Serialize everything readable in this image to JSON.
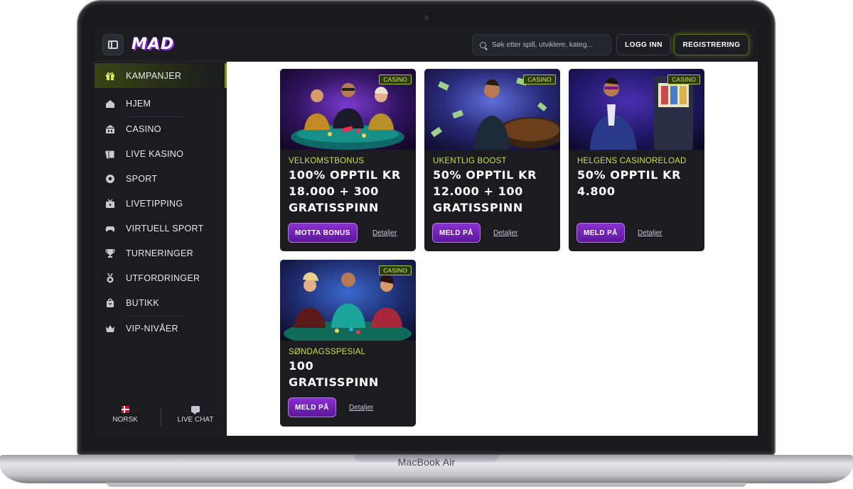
{
  "device": {
    "brand_label": "MacBook Air"
  },
  "header": {
    "logo": "MAD",
    "search_placeholder": "Søk etter spill, utviklere, kateg...",
    "login_label": "LOGG INN",
    "register_label": "REGISTRERING"
  },
  "sidebar": {
    "items": [
      {
        "label": "KAMPANJER",
        "icon": "gift-icon",
        "active": true
      },
      {
        "label": "HJEM",
        "icon": "home-icon"
      },
      {
        "label": "CASINO",
        "icon": "casino-building-icon"
      },
      {
        "label": "LIVE KASINO",
        "icon": "cards-icon"
      },
      {
        "label": "SPORT",
        "icon": "soccer-ball-icon"
      },
      {
        "label": "LIVETIPPING",
        "icon": "live-tv-icon"
      },
      {
        "label": "VIRTUELL SPORT",
        "icon": "gamepad-icon"
      },
      {
        "label": "TURNERINGER",
        "icon": "trophy-icon"
      },
      {
        "label": "UTFORDRINGER",
        "icon": "medal-icon"
      },
      {
        "label": "BUTIKK",
        "icon": "shopping-bag-icon"
      },
      {
        "label": "VIP-NIVÅER",
        "icon": "crown-icon"
      }
    ],
    "footer": {
      "language": "NORSK",
      "chat": "LIVE CHAT"
    }
  },
  "promotions": [
    {
      "badge": "CASINO",
      "eyebrow": "VELKOMSTBONUS",
      "title": "100% OPPTIL KR 18.000 + 300 GRATISSPINN",
      "cta": "MOTTA BONUS",
      "details": "Detaljer"
    },
    {
      "badge": "CASINO",
      "eyebrow": "UKENTLIG BOOST",
      "title": "50% OPPTIL KR 12.000 + 100 GRATISSPINN",
      "cta": "MELD PÅ",
      "details": "Detaljer"
    },
    {
      "badge": "CASINO",
      "eyebrow": "HELGENS CASINORELOAD",
      "title": "50% OPPTIL KR 4.800",
      "cta": "MELD PÅ",
      "details": "Detaljer"
    },
    {
      "badge": "CASINO",
      "eyebrow": "SØNDAGSSPESIAL",
      "title": "100 GRATISSPINN",
      "cta": "MELD PÅ",
      "details": "Detaljer"
    }
  ],
  "colors": {
    "accent_lime": "#c6e34a",
    "cta_purple": "#7a25c0",
    "panel_dark": "#1b1b20"
  }
}
